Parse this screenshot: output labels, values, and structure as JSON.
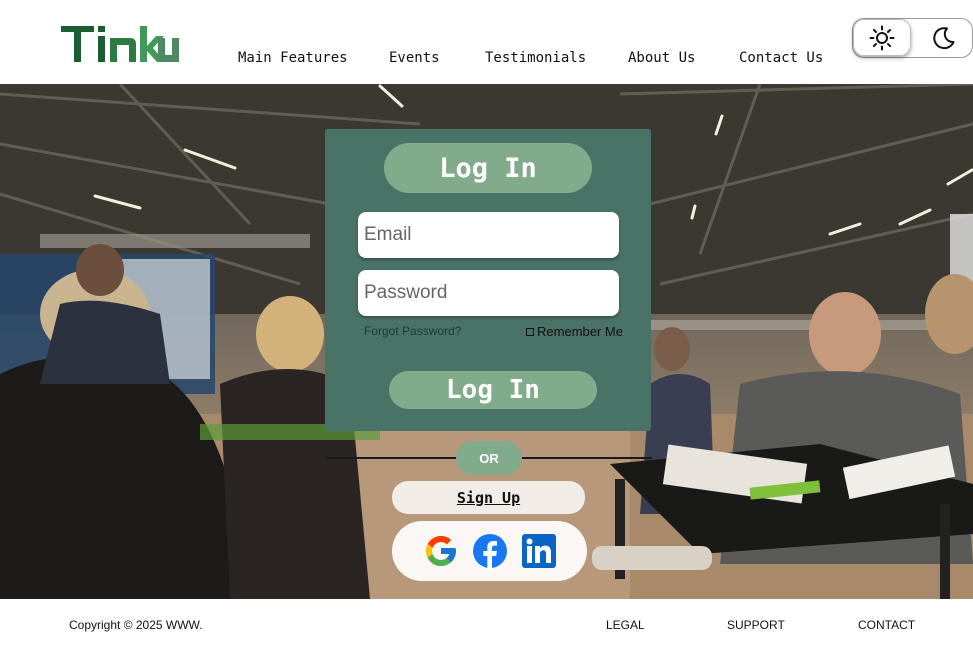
{
  "brand": {
    "logo_text": "Tinku",
    "color_dark": "#1c5e34",
    "color_light": "#3f9a5a"
  },
  "nav": {
    "items": [
      {
        "label": "Main Features"
      },
      {
        "label": "Events"
      },
      {
        "label": "Testimonials"
      },
      {
        "label": "About Us"
      },
      {
        "label": "Contact Us"
      }
    ]
  },
  "theme_toggle": {
    "light_icon": "sun-icon",
    "dark_icon": "moon-icon",
    "selected": "light"
  },
  "login": {
    "title": "Log In",
    "email_placeholder": "Email",
    "password_placeholder": "Password",
    "forgot_label": "Forgot Password?",
    "remember_label": "Remember Me",
    "submit_label": "Log In"
  },
  "or_label": "OR",
  "signup_label": "Sign Up",
  "socials": [
    "google-icon",
    "facebook-icon",
    "linkedin-icon"
  ],
  "footer": {
    "copyright": "Copyright © 2025 WWW.",
    "links": [
      {
        "label": "LEGAL"
      },
      {
        "label": "SUPPORT"
      },
      {
        "label": "CONTACT"
      }
    ]
  },
  "colors": {
    "card_bg": "#4a7367",
    "accent": "#82ab8c"
  }
}
